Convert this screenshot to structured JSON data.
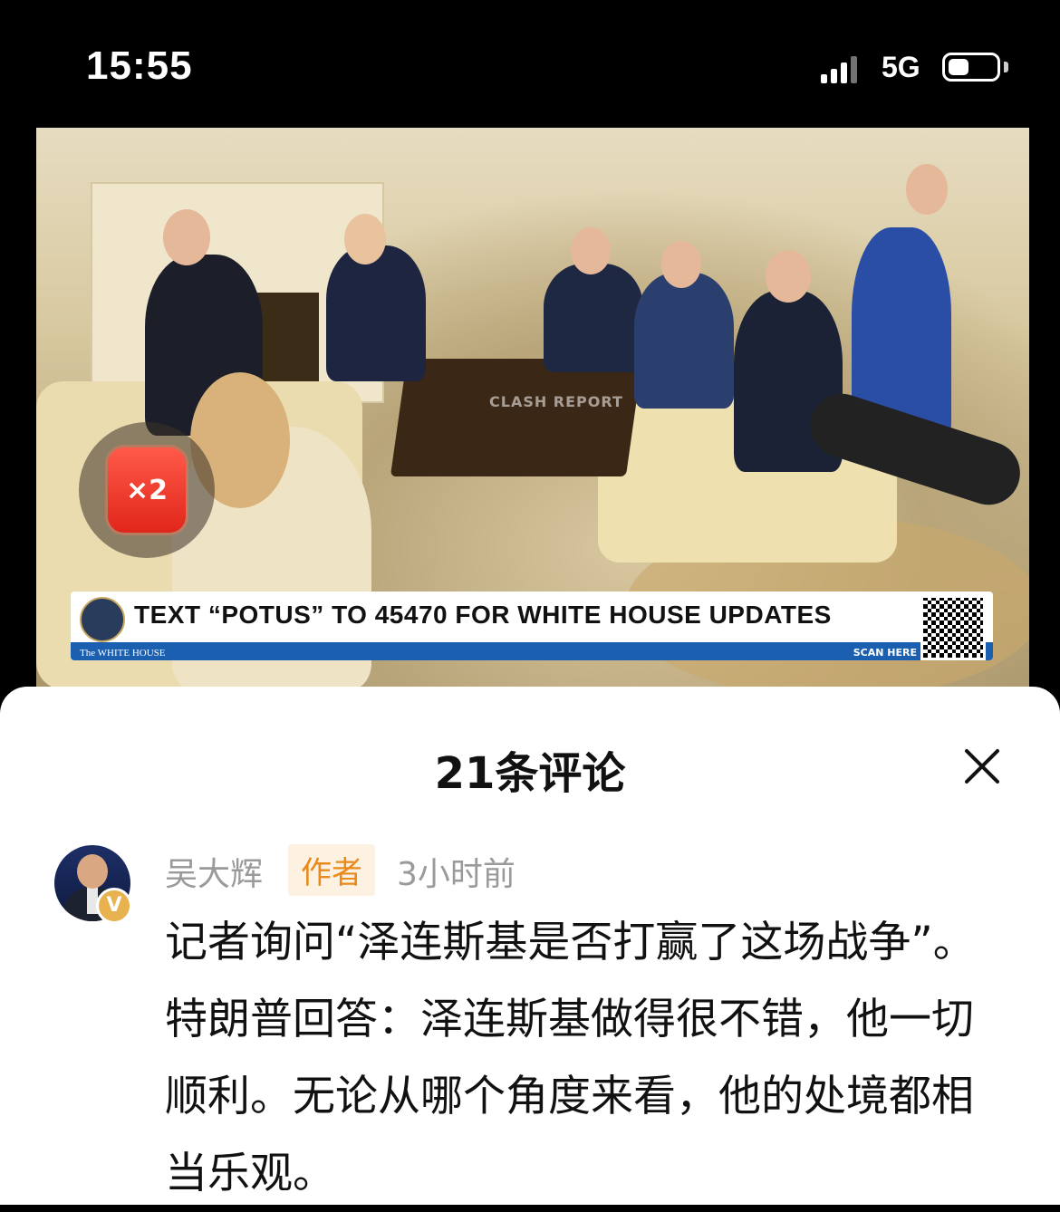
{
  "status_bar": {
    "time": "15:55",
    "network": "5G",
    "signal_icon": "signal-bars-icon",
    "battery_icon": "battery-icon",
    "battery_level": 0.3
  },
  "video": {
    "badge_text": "×2",
    "watermark": "CLASH REPORT",
    "banner": {
      "headline": "TEXT “POTUS” TO 45470 FOR WHITE HOUSE UPDATES",
      "footer_left": "The WHITE HOUSE",
      "footer_right": "SCAN HERE"
    }
  },
  "comments_panel": {
    "title": "21条评论",
    "close_icon": "close-icon",
    "comment": {
      "user_name": "吴大辉",
      "author_tag": "作者",
      "time": "3小时前",
      "verified_badge": "V",
      "text": "记者询问“泽连斯基是否打赢了这场战争”。 特朗普回答：泽连斯基做得很不错，他一切顺利。无论从哪个角度来看，他的处境都相当乐观。"
    }
  },
  "colors": {
    "author_tag_text": "#e88a1c",
    "author_tag_bg": "#fdf1e2",
    "verified_badge": "#e8b24e",
    "banner_strip": "#1b5fb0"
  }
}
